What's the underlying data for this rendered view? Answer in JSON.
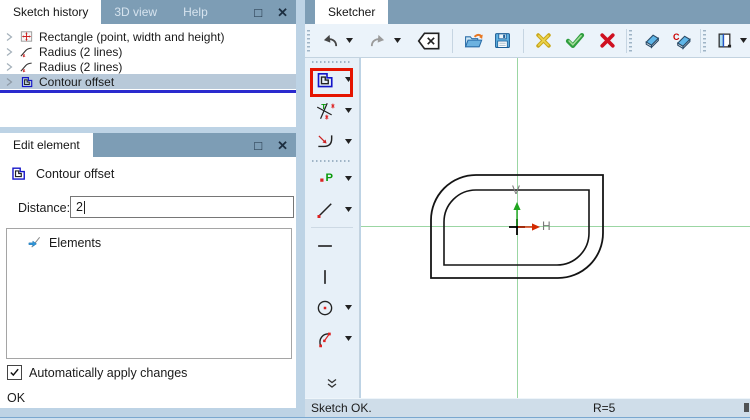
{
  "history_panel": {
    "tabs": [
      {
        "label": "Sketch history",
        "active": true
      },
      {
        "label": "3D view",
        "active": false
      },
      {
        "label": "Help",
        "active": false
      }
    ],
    "maximize_glyph": "□",
    "close_glyph": "✕",
    "items": [
      {
        "icon": "rectangle-feature-icon",
        "label": "Rectangle (point, width and height)",
        "selected": false
      },
      {
        "icon": "radius-feature-icon",
        "label": "Radius (2 lines)",
        "selected": false
      },
      {
        "icon": "radius-feature-icon",
        "label": "Radius (2 lines)",
        "selected": false
      },
      {
        "icon": "contour-offset-feature-icon",
        "label": "Contour offset",
        "selected": true
      }
    ]
  },
  "edit_panel": {
    "title": "Edit element",
    "maximize_glyph": "□",
    "close_glyph": "✕",
    "element_icon": "contour-offset-icon",
    "element_name": "Contour offset",
    "distance_label": "Distance:",
    "distance_value": "2",
    "elements_icon": "elements-icon",
    "elements_label": "Elements",
    "auto_apply_label": "Automatically apply changes",
    "auto_apply_checked": true,
    "ok_label": "OK"
  },
  "sketcher": {
    "tab_label": "Sketcher",
    "toolbar_icons": [
      "undo-icon",
      "dropdown-icon",
      "redo-icon",
      "dropdown-icon",
      "backspace-delete-icon",
      "open-sketch-icon",
      "save-sketch-icon",
      "cancel-yellow-icon",
      "confirm-check-icon",
      "delete-red-icon",
      "eraser-icon",
      "eraser-clear-icon",
      "sketch-plane-icon",
      "dropdown-icon"
    ],
    "tool_icons": [
      "contour-offset-icon",
      "trim-extend-icon",
      "fillet-icon",
      "point-icon",
      "line-icon",
      "horizontal-line-icon",
      "vertical-line-icon",
      "circle-icon",
      "arc-icon",
      "more-tools-chevron-icon"
    ],
    "selected_tool": "contour-offset",
    "glyphs": {
      "trim_t": "T",
      "point_p": "P",
      "clear_c": "C"
    },
    "axis": {
      "v_label": "V",
      "h_label": "H"
    },
    "status": {
      "message": "Sketch OK.",
      "radius_readout": "R=5"
    }
  },
  "colors": {
    "tab_bar_bg": "#7d9db5",
    "frame_bg": "#bdd3e5",
    "toolbar_bg": "#ebf3fa",
    "selected_row_bg": "#b8c9d9",
    "selected_row_underline": "#2a2ace",
    "tool_highlight_border": "#e51400",
    "axis_green": "#9bd6a3",
    "status_bar_bg": "#cfdde9",
    "sketch_stroke": "#141414"
  }
}
